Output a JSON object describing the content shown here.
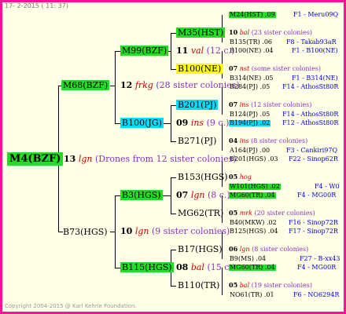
{
  "header": "17-  2-2015 ( 11: 37)",
  "footer": "Copyright 2004-2015 @ Karl Kehrle Foundation.",
  "root": {
    "label": "M4(BZF)",
    "count": "13",
    "name": "lgn",
    "sisters": "(Drones from 12 sister colonies)"
  },
  "level1": [
    {
      "label": "M68(BZF)",
      "count": "12",
      "name": "frkg",
      "sisters": "(28 sister colonies)"
    },
    {
      "label": "B73(HGS)",
      "count": "10",
      "name": "lgn",
      "sisters": "(9 sister colonies)"
    }
  ],
  "level2": [
    {
      "label": "M99(BZF)",
      "count": "11",
      "name": "val",
      "sisters": "(12 c.)"
    },
    {
      "label": "B100(JG)",
      "count": "09",
      "name": "ins",
      "sisters": "(9 c.)"
    },
    {
      "label": "B3(HGS)",
      "count": "07",
      "name": "lgn",
      "sisters": "(8 c.)"
    },
    {
      "label": "B115(HGS)",
      "count": "08",
      "name": "bal",
      "sisters": "(15 c.)"
    }
  ],
  "level3": [
    {
      "label": "M35(HST)",
      "count": "10",
      "name": "bal",
      "sisters": "(23 sister colonies)"
    },
    {
      "label": "B100(NE)",
      "count": "07",
      "name": "nst",
      "sisters": "(some sister colonies)"
    },
    {
      "label": "B201(PJ)",
      "count": "07",
      "name": "ins",
      "sisters": "(12 sister colonies)"
    },
    {
      "label": "B271(PJ)",
      "count": "04",
      "name": "ins",
      "sisters": "(8 sister colonies)"
    },
    {
      "label": "B153(HGS)",
      "count": "05",
      "name": "hog",
      "sisters": ""
    },
    {
      "label": "MG62(TR)",
      "count": "05",
      "name": "mrk",
      "sisters": "(20 sister colonies)"
    },
    {
      "label": "B17(HGS)",
      "count": "06",
      "name": "lgn",
      "sisters": "(8 sister colonies)"
    },
    {
      "label": "B110(TR)",
      "count": "05",
      "name": "bal",
      "sisters": "(19 sister colonies)"
    }
  ],
  "level4": [
    {
      "label": "M24(HST) .09",
      "right": "F1 - Meru09Q"
    },
    {
      "label": "B135(TR) .06",
      "right": "F8 - Takab93aR"
    },
    {
      "label": "B100(NE) .04",
      "right": "F1 - B100(NE)"
    },
    {
      "label": "B314(NE) .05",
      "right": "F1 - B314(NE)"
    },
    {
      "label": "B284(PJ) .05",
      "right": "F14 - AthosSt80R"
    },
    {
      "label": "B124(PJ) .05",
      "right": "F14 - AthosSt80R"
    },
    {
      "label": "B194(PJ) .02",
      "right": "F12 - AthosSt80R"
    },
    {
      "label": "A164(PJ) .00",
      "right": "F3 - Cankiri97Q"
    },
    {
      "label": "B201(HGS) .03",
      "right": "F22 - Sinop62R"
    },
    {
      "label": "W101(HGS) .02",
      "right": "F4 - W0"
    },
    {
      "label": "MG60(TR) .04",
      "right": "F4 - MG00R"
    },
    {
      "label": "B40(MKW) .02",
      "right": "F16 - Sinop72R"
    },
    {
      "label": "B125(HGS) .04",
      "right": "F17 - Sinop72R"
    },
    {
      "label": "B9(MS) .04",
      "right": "F27 - B-xx43"
    },
    {
      "label": "MG60(TR) .04",
      "right": "F4 - MG00R"
    },
    {
      "label": "NO61(TR) .01",
      "right": "F6 - NO6294R"
    }
  ]
}
